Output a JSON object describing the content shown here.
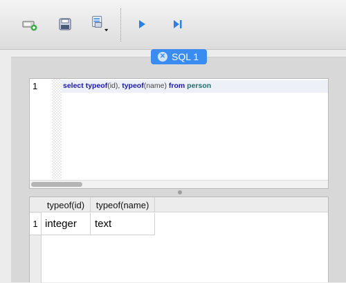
{
  "toolbar": {
    "buttons": [
      {
        "icon": "add-connection-icon"
      },
      {
        "icon": "save-icon"
      },
      {
        "icon": "save-as-icon-with-dropdown"
      },
      {
        "icon": "run-icon"
      },
      {
        "icon": "run-current-statement-icon"
      }
    ]
  },
  "tab": {
    "label": "SQL 1",
    "close_glyph": "✕"
  },
  "editor": {
    "line_number": "1",
    "code": {
      "kw_select": "select",
      "fn1": "typeof",
      "arg1": "(id)",
      "comma": ", ",
      "fn2": "typeof",
      "arg2": "(name)",
      "kw_from": "from",
      "table": "person"
    }
  },
  "results": {
    "columns": [
      "typeof(id)",
      "typeof(name)"
    ],
    "rows": [
      {
        "num": "1",
        "cells": [
          "integer",
          "text"
        ]
      }
    ]
  },
  "colors": {
    "accent": "#3a8cf0",
    "keyword": "#1a1aa6",
    "table": "#1f6f6f"
  }
}
